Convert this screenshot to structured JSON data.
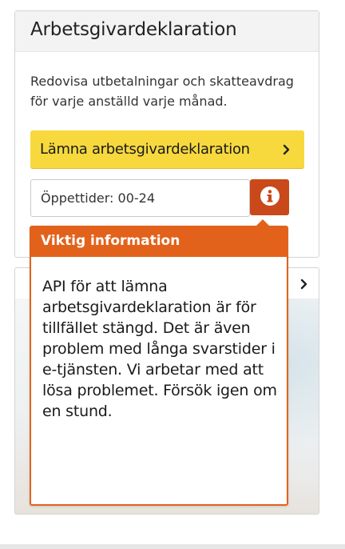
{
  "card": {
    "title": "Arbetsgivardeklaration",
    "description": "Redovisa utbetalningar och skatteavdrag för varje anställd varje månad.",
    "primary_button_label": "Lämna arbetsgivardeklaration",
    "opening_hours": "Öppettider: 00-24",
    "info_icon": "info-icon",
    "chevron_icon": "chevron-right-icon"
  },
  "popup": {
    "title": "Viktig information",
    "body": "API för att lämna arbetsgivardeklaration är för tillfället stängd. Det är även problem med långa svarstider i e-tjänsten. Vi arbetar med att lösa problemet. Försök igen om en stund."
  },
  "colors": {
    "accent_yellow": "#f7d93e",
    "warning_orange": "#e2621b",
    "info_button": "#c9491a"
  }
}
